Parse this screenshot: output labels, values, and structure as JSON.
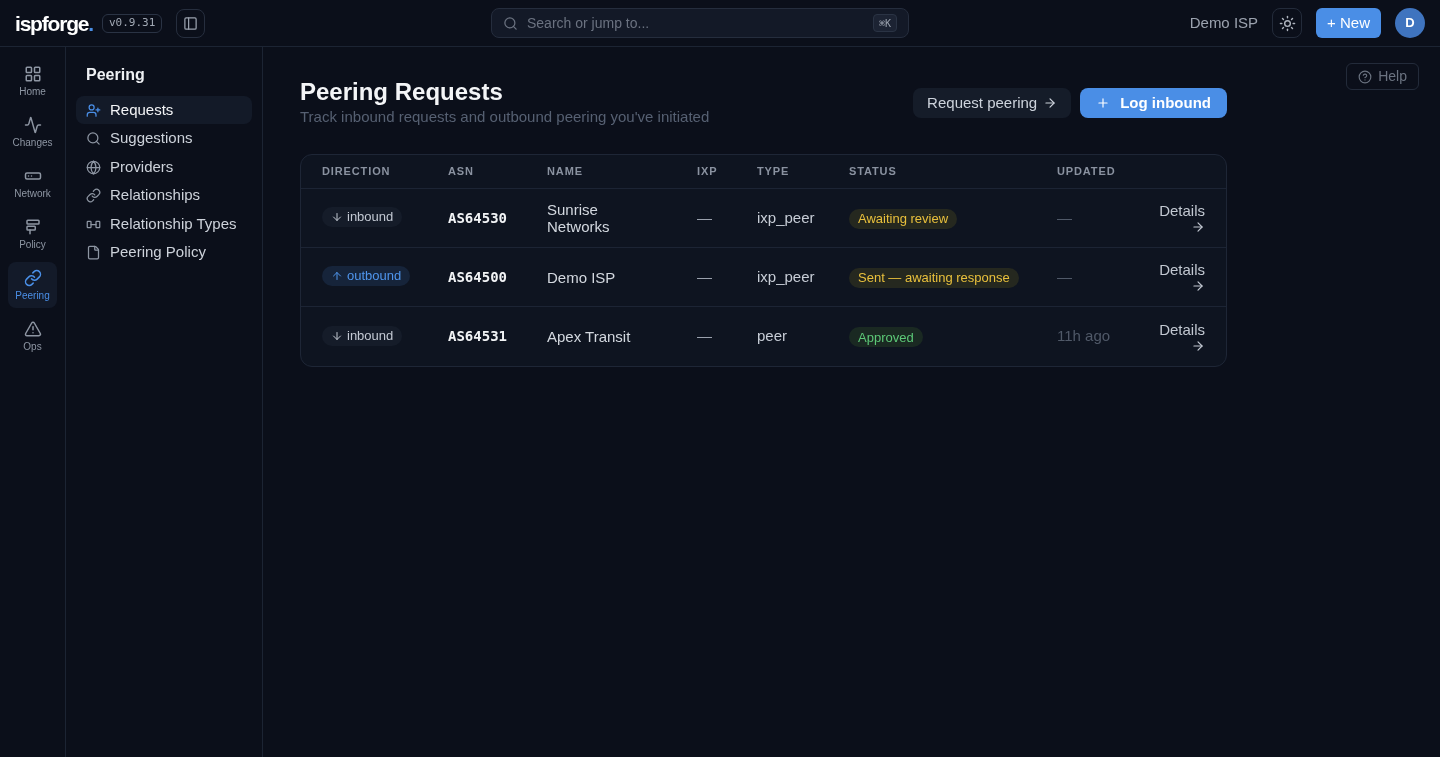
{
  "topbar": {
    "logo": {
      "name": "ispforge",
      "accent": "."
    },
    "version": "v0.9.31",
    "search": {
      "placeholder": "Search or jump to...",
      "shortcut": "⌘K"
    },
    "org": "Demo ISP",
    "new_button": "+ New",
    "avatar": "D"
  },
  "rail": [
    {
      "label": "Home",
      "selected": false
    },
    {
      "label": "Changes",
      "selected": false
    },
    {
      "label": "Network",
      "selected": false
    },
    {
      "label": "Policy",
      "selected": false
    },
    {
      "label": "Peering",
      "selected": true
    },
    {
      "label": "Ops",
      "selected": false
    }
  ],
  "sidebar": {
    "title": "Peering",
    "items": [
      {
        "label": "Requests",
        "selected": true
      },
      {
        "label": "Suggestions",
        "selected": false
      },
      {
        "label": "Providers",
        "selected": false
      },
      {
        "label": "Relationships",
        "selected": false
      },
      {
        "label": "Relationship Types",
        "selected": false
      },
      {
        "label": "Peering Policy",
        "selected": false
      }
    ]
  },
  "help": "Help",
  "page": {
    "title": "Peering Requests",
    "subtitle": "Track inbound requests and outbound peering you've initiated",
    "actions": [
      {
        "label": "Request peering",
        "kind": "secondary"
      },
      {
        "label": "Log inbound",
        "kind": "primary"
      }
    ]
  },
  "table": {
    "columns": [
      "DIRECTION",
      "ASN",
      "NAME",
      "IXP",
      "TYPE",
      "STATUS",
      "UPDATED"
    ],
    "rows": [
      {
        "direction": {
          "label": "inbound",
          "kind": "inbound"
        },
        "asn": "AS64530",
        "name": "Sunrise Networks",
        "ixp": "—",
        "type": "ixp_peer",
        "status": {
          "label": "Awaiting review",
          "kind": "warning"
        },
        "updated": "—",
        "action": "Details"
      },
      {
        "direction": {
          "label": "outbound",
          "kind": "outbound"
        },
        "asn": "AS64500",
        "name": "Demo ISP",
        "ixp": "—",
        "type": "ixp_peer",
        "status": {
          "label": "Sent — awaiting response",
          "kind": "warning"
        },
        "updated": "—",
        "action": "Details"
      },
      {
        "direction": {
          "label": "inbound",
          "kind": "inbound"
        },
        "asn": "AS64531",
        "name": "Apex Transit",
        "ixp": "—",
        "type": "peer",
        "status": {
          "label": "Approved",
          "kind": "success"
        },
        "updated": "11h ago",
        "action": "Details"
      }
    ]
  }
}
